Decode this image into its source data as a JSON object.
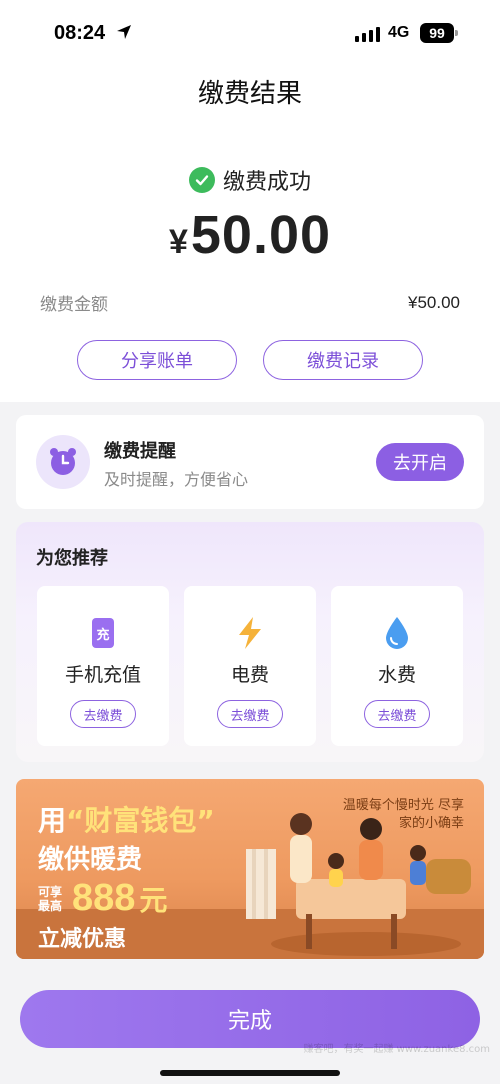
{
  "status_bar": {
    "time": "08:24",
    "network": "4G",
    "battery": "99"
  },
  "nav": {
    "title": "缴费结果"
  },
  "result": {
    "status_text": "缴费成功",
    "currency": "¥",
    "amount": "50.00",
    "fee_label": "缴费金额",
    "fee_value": "¥50.00",
    "share_bill_label": "分享账单",
    "records_label": "缴费记录"
  },
  "reminder": {
    "title": "缴费提醒",
    "subtitle": "及时提醒，方便省心",
    "button_label": "去开启"
  },
  "recommend": {
    "title": "为您推荐",
    "items": [
      {
        "label": "手机充值",
        "button": "去缴费",
        "icon": "phone-recharge-icon"
      },
      {
        "label": "电费",
        "button": "去缴费",
        "icon": "lightning-icon"
      },
      {
        "label": "水费",
        "button": "去缴费",
        "icon": "water-drop-icon"
      }
    ]
  },
  "banner": {
    "line1_prefix": "用",
    "line1_highlight": "“财富钱包”",
    "line2": "缴供暖费",
    "line3_small": "可享最高",
    "line3_big": "888",
    "line3_unit": "元",
    "line4": "立减优惠",
    "slogan": "温暖每个慢时光 尽享家的小确幸"
  },
  "footer": {
    "done_label": "完成",
    "watermark": "赚客吧，有奖一起赚 www.zuanke8.com"
  },
  "colors": {
    "accent": "#8c5fe3",
    "success": "#3dbb5c"
  }
}
